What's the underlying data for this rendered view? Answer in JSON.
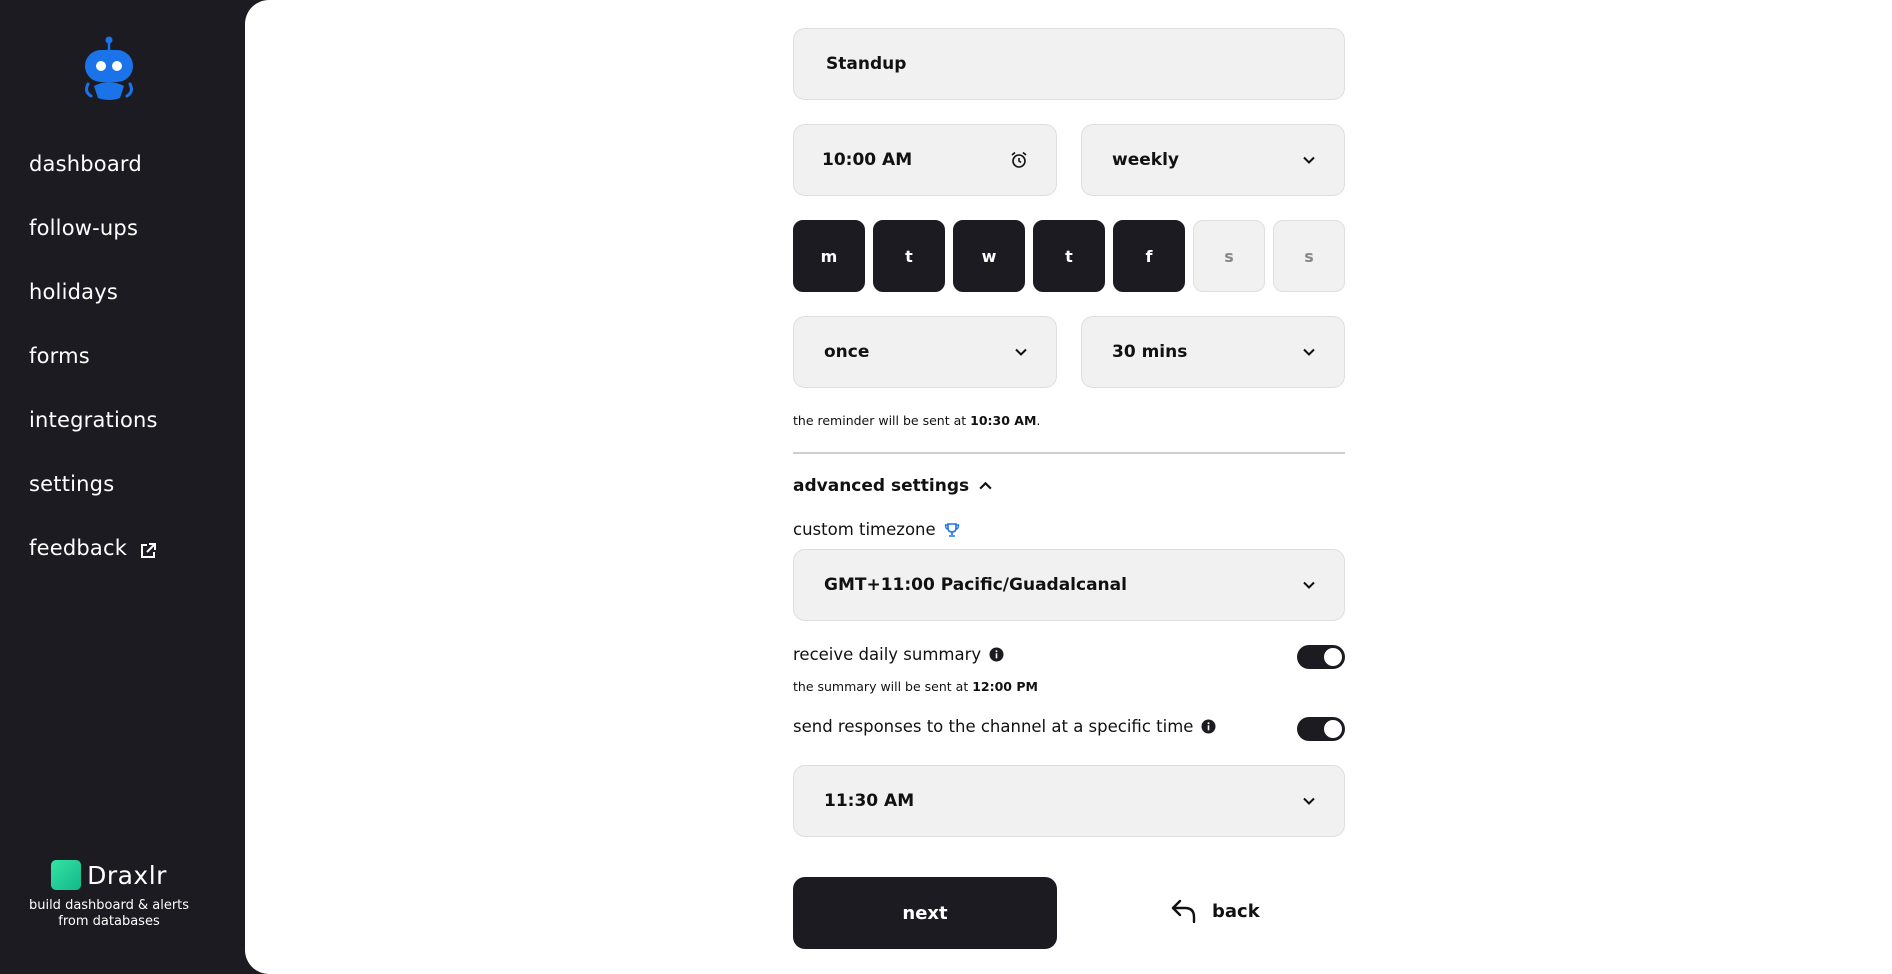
{
  "sidebar": {
    "nav": [
      {
        "label": "dashboard"
      },
      {
        "label": "follow-ups"
      },
      {
        "label": "holidays"
      },
      {
        "label": "forms"
      },
      {
        "label": "integrations"
      },
      {
        "label": "settings"
      },
      {
        "label": "feedback"
      }
    ],
    "brand": {
      "name": "Draxlr",
      "tagline": "build dashboard & alerts from databases"
    }
  },
  "form": {
    "name_value": "Standup",
    "time_value": "10:00 AM",
    "frequency_value": "weekly",
    "days": [
      {
        "label": "m",
        "selected": true
      },
      {
        "label": "t",
        "selected": true
      },
      {
        "label": "w",
        "selected": true
      },
      {
        "label": "t",
        "selected": true
      },
      {
        "label": "f",
        "selected": true
      },
      {
        "label": "s",
        "selected": false
      },
      {
        "label": "s",
        "selected": false
      }
    ],
    "reminder_value": "once",
    "reminder_delay_value": "30 mins",
    "reminder_note_prefix": "the reminder will be sent at",
    "reminder_note_time": "10:30 AM",
    "reminder_note_suffix": ".",
    "advanced_label": "advanced settings",
    "timezone_label": "custom timezone",
    "timezone_value": "GMT+11:00 Pacific/Guadalcanal",
    "daily_summary_label": "receive daily summary",
    "daily_summary_enabled": true,
    "summary_note_prefix": "the summary will be sent at",
    "summary_note_time": "12:00 PM",
    "channel_label": "send responses to the channel at a specific time",
    "channel_enabled": true,
    "channel_time_value": "11:30 AM",
    "next_label": "next",
    "back_label": "back"
  },
  "colors": {
    "sidebar_bg": "#1c1b21",
    "accent_blue": "#1a73e8",
    "brand_green": "#1fcf95"
  }
}
